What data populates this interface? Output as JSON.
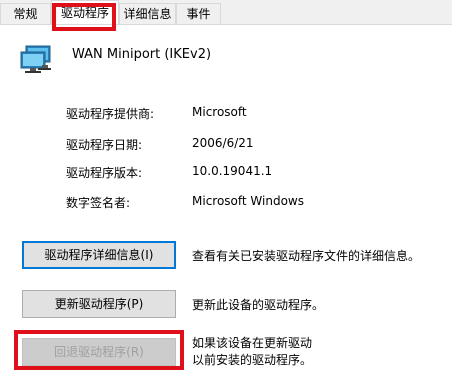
{
  "tabs": [
    {
      "label": "常规",
      "active": false
    },
    {
      "label": "驱动程序",
      "active": true
    },
    {
      "label": "详细信息",
      "active": false
    },
    {
      "label": "事件",
      "active": false
    }
  ],
  "device": {
    "name": "WAN Miniport (IKEv2)",
    "icon": "network-adapter-icon"
  },
  "info": [
    {
      "label": "驱动程序提供商:",
      "value": "Microsoft"
    },
    {
      "label": "驱动程序日期:",
      "value": "2006/6/21"
    },
    {
      "label": "驱动程序版本:",
      "value": "10.0.19041.1"
    },
    {
      "label": "数字签名者:",
      "value": "Microsoft Windows"
    }
  ],
  "buttons": [
    {
      "label": "驱动程序详细信息(I)",
      "description": "查看有关已安装驱动程序文件的详细信息。",
      "enabled": true
    },
    {
      "label": "更新驱动程序(P)",
      "description": "更新此设备的驱动程序。",
      "enabled": true
    },
    {
      "label": "回退驱动程序(R)",
      "description": "如果该设备在更新驱动以前安装的驱动程序。",
      "description_lines": [
        "如果该设备在更新驱动",
        "以前安装的驱动程序。"
      ],
      "enabled": false
    }
  ],
  "colors": {
    "highlight": "#e0101b",
    "focus": "#0078d7",
    "disabled_text": "#a0a0a0"
  }
}
